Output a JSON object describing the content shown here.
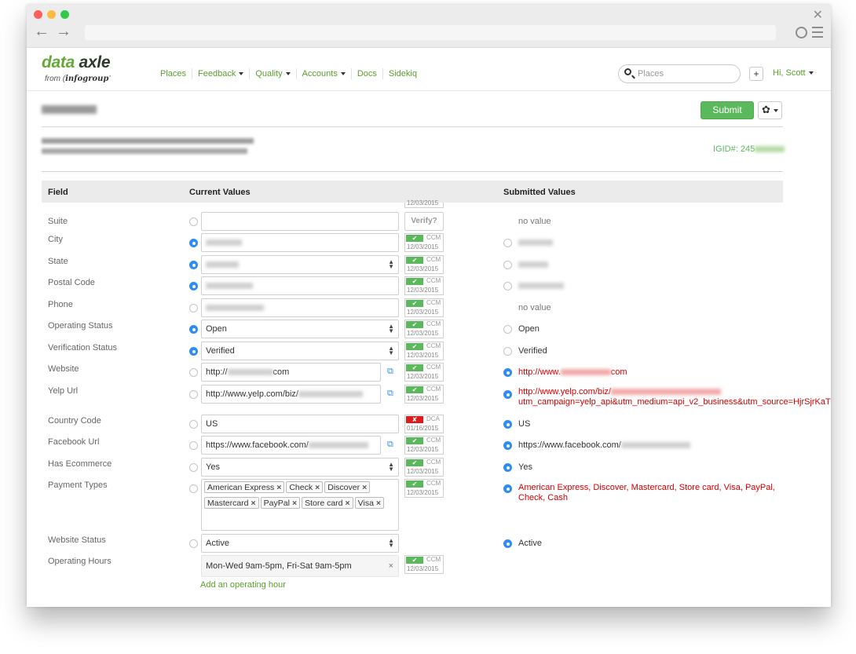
{
  "browser": {
    "back": "←",
    "forward": "→",
    "close": "✕"
  },
  "logo": {
    "brand_d": "d",
    "brand_ata": "ata",
    "brand_axle": "axle",
    "from": "from",
    "parent": "infogroup"
  },
  "nav": {
    "items": [
      {
        "label": "Places",
        "caret": false
      },
      {
        "label": "Feedback",
        "caret": true
      },
      {
        "label": "Quality",
        "caret": true
      },
      {
        "label": "Accounts",
        "caret": true
      },
      {
        "label": "Docs",
        "caret": false
      },
      {
        "label": "Sidekiq",
        "caret": false
      }
    ],
    "search_placeholder": "Places",
    "plus": "+",
    "user": "Hi, Scott"
  },
  "header": {
    "submit": "Submit",
    "gear": "✿",
    "igid_label": "IGID#: 245"
  },
  "table": {
    "col_field": "Field",
    "col_current": "Current Values",
    "col_submitted": "Submitted Values",
    "top_partial_date": "12/03/2015",
    "verify": "Verify?",
    "external_icon": "⧉",
    "add_hour": "Add an operating hour"
  },
  "rows": {
    "suite": {
      "label": "Suite",
      "submitted": "no value"
    },
    "city": {
      "label": "City",
      "source": "CCM",
      "date": "12/03/2015"
    },
    "state": {
      "label": "State",
      "source": "CCM",
      "date": "12/03/2015"
    },
    "postal": {
      "label": "Postal Code",
      "source": "CCM",
      "date": "12/03/2015"
    },
    "phone": {
      "label": "Phone",
      "source": "CCM",
      "date": "12/03/2015",
      "submitted": "no value"
    },
    "opstatus": {
      "label": "Operating Status",
      "value": "Open",
      "source": "CCM",
      "date": "12/03/2015",
      "submitted": "Open"
    },
    "verstatus": {
      "label": "Verification Status",
      "value": "Verified",
      "source": "CCM",
      "date": "12/03/2015",
      "submitted": "Verified"
    },
    "website": {
      "label": "Website",
      "value_prefix": "http://",
      "value_suffix": "com",
      "source": "CCM",
      "date": "12/03/2015",
      "submitted_prefix": "http://www.",
      "submitted_suffix": "com"
    },
    "yelp": {
      "label": "Yelp Url",
      "value_prefix": "http://www.yelp.com/biz/",
      "source": "CCM",
      "date": "12/03/2015",
      "submitted_line1": "http://www.yelp.com/biz/",
      "submitted_line2": "utm_campaign=yelp_api&utm_medium=api_v2_business&utm_source=HjrSjrKaT"
    },
    "country": {
      "label": "Country Code",
      "value": "US",
      "source": "DCA",
      "date": "01/16/2015",
      "submitted": "US"
    },
    "facebook": {
      "label": "Facebook Url",
      "value_prefix": "https://www.facebook.com/",
      "source": "CCM",
      "date": "12/03/2015",
      "submitted_prefix": "https://www.facebook.com/"
    },
    "ecommerce": {
      "label": "Has Ecommerce",
      "value": "Yes",
      "source": "CCM",
      "date": "12/03/2015",
      "submitted": "Yes"
    },
    "payment": {
      "label": "Payment Types",
      "tags": [
        "American Express",
        "Check",
        "Discover",
        "Mastercard",
        "PayPal",
        "Store card",
        "Visa"
      ],
      "source": "CCM",
      "date": "12/03/2015",
      "submitted_line1": "American Express, Discover, Mastercard, Store card, Visa, PayPal,",
      "submitted_line2": "Check, Cash"
    },
    "webstatus": {
      "label": "Website Status",
      "value": "Active",
      "submitted": "Active"
    },
    "hours": {
      "label": "Operating Hours",
      "value": "Mon-Wed 9am-5pm, Fri-Sat 9am-5pm",
      "remove": "×",
      "source": "CCM",
      "date": "12/03/2015"
    }
  },
  "colors": {
    "accent_green": "#5aa02c",
    "submit_green": "#5cb85c",
    "radio_blue": "#2f8cf0",
    "alert_red": "#d60000"
  }
}
